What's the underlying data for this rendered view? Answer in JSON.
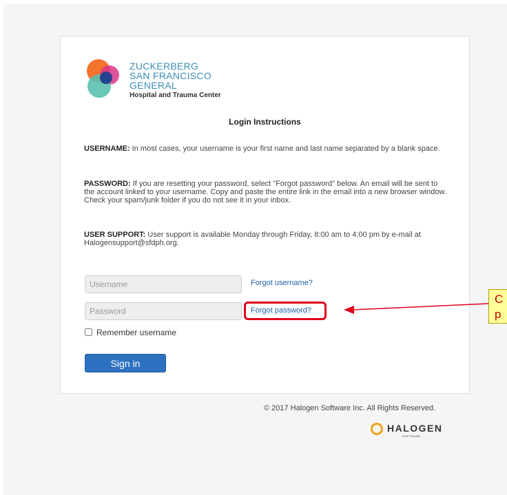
{
  "logo": {
    "line1": "ZUCKERBERG",
    "line2": "SAN FRANCISCO GENERAL",
    "line3": "Hospital and Trauma Center"
  },
  "instructions": {
    "heading": "Login Instructions",
    "username": {
      "label": "USERNAME:",
      "text": " In most cases, your username is your first name and last name separated by a blank space."
    },
    "password": {
      "label": "PASSWORD:",
      "text": " If you are resetting your password, select \"Forgot password\" below. An email will be sent to the account linked to your username. Copy and paste the entire link in the email into a new browser window. Check your spam/junk folder if you do not see it in your inbox."
    },
    "support": {
      "label": "USER SUPPORT:",
      "text": " User support is available Monday through Friday, 8:00 am to 4:00 pm by e-mail at Halogensupport@sfdph.org."
    }
  },
  "form": {
    "username_placeholder": "Username",
    "password_placeholder": "Password",
    "forgot_username": "Forgot username?",
    "forgot_password": "Forgot password?",
    "remember_label": "Remember username",
    "signin_label": "Sign in"
  },
  "footer": {
    "copyright": "© 2017 Halogen Software Inc. All Rights Reserved.",
    "halogen_word": "HALOGEN",
    "halogen_sub": "SOFTWARE"
  },
  "callout": {
    "line1": "C",
    "line2": "p"
  },
  "colors": {
    "link": "#1f5fa8",
    "button": "#2d72c0",
    "highlight": "#e2001a",
    "callout_bg": "#ffff99"
  }
}
